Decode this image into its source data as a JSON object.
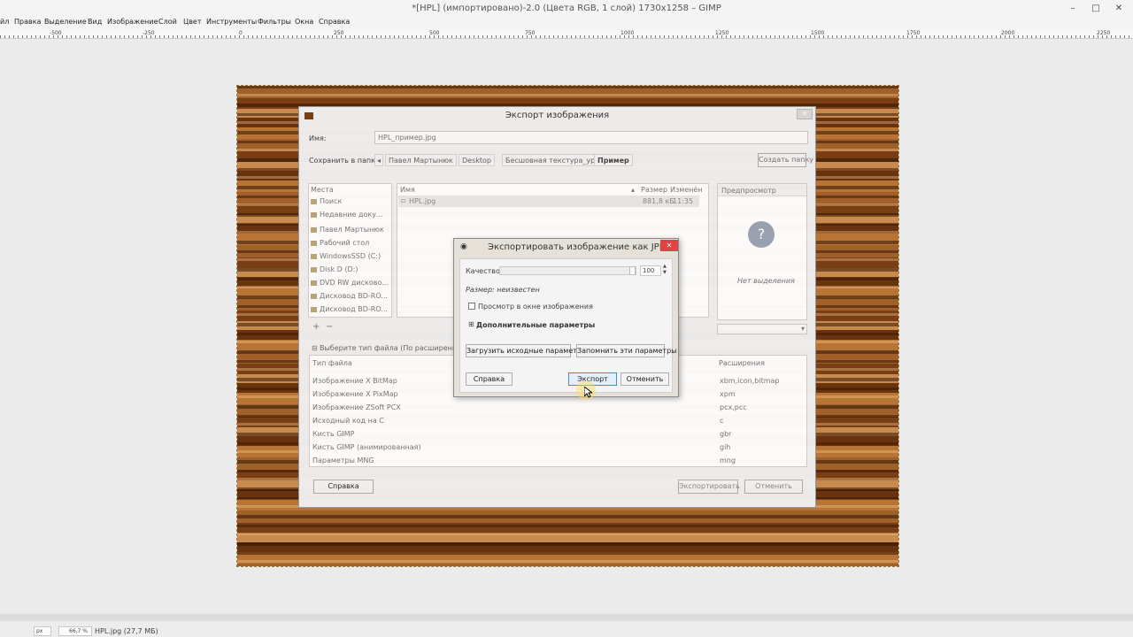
{
  "window": {
    "title": "*[HPL] (импортировано)-2.0 (Цвета RGB, 1 слой) 1730x1258 – GIMP",
    "controls": [
      "–",
      "□",
      "✕"
    ]
  },
  "menubar": {
    "items": [
      "йл",
      "Правка",
      "Выделение",
      "Вид",
      "Изображение",
      "Слой",
      "Цвет",
      "Инструменты",
      "Фильтры",
      "Окна",
      "Справка"
    ]
  },
  "ruler": {
    "labels": [
      "-500",
      "-250",
      "0",
      "250",
      "500",
      "750",
      "1000",
      "1250",
      "1500",
      "1750",
      "2000",
      "2250"
    ]
  },
  "export_dialog": {
    "title": "Экспорт изображения",
    "name_label": "Имя:",
    "name_value": "HPL_пример.jpg",
    "save_in_label": "Сохранить в папке",
    "breadcrumbs": [
      "Павел Мартынюк",
      "Desktop",
      "Бесшовная текстура_урок",
      "Пример"
    ],
    "create_folder": "Создать папку",
    "places_header": "Места",
    "places": [
      "Поиск",
      "Недавние доку...",
      "Павел Мартынюк",
      "Рабочий стол",
      "WindowsSSD (C:)",
      "Disk D (D:)",
      "DVD RW дисково...",
      "Дисковод BD-RO...",
      "Дисковод BD-RO..."
    ],
    "file_columns": [
      "Имя",
      "Размер",
      "Изменён"
    ],
    "files": [
      {
        "name": "HPL.jpg",
        "size": "881,8 кБ",
        "modified": "11:35"
      }
    ],
    "preview_header": "Предпросмотр",
    "preview_text": "Нет выделения",
    "filetype_toggle": "Выберите тип файла (По расширению)",
    "filetype_columns": [
      "Тип файла",
      "Расширения"
    ],
    "filetypes": [
      {
        "type": "Изображение X BitMap",
        "ext": "xbm,icon,bitmap"
      },
      {
        "type": "Изображение X PixMap",
        "ext": "xpm"
      },
      {
        "type": "Изображение ZSoft PCX",
        "ext": "pcx,pcc"
      },
      {
        "type": "Исходный код на C",
        "ext": "c"
      },
      {
        "type": "Кисть GIMP",
        "ext": "gbr"
      },
      {
        "type": "Кисть GIMP (анимированная)",
        "ext": "gih"
      },
      {
        "type": "Параметры MNG",
        "ext": "mng"
      }
    ],
    "help_button": "Справка",
    "export_button": "Экспортировать",
    "cancel_button": "Отменить"
  },
  "jpeg_dialog": {
    "title": "Экспортировать изображение как JPEG",
    "quality_label": "Качество:",
    "quality_value": "100",
    "quality_fraction": 1.0,
    "size_text": "Размер: неизвестен",
    "preview_checkbox": "Просмотр в окне изображения",
    "advanced_label": "Дополнительные параметры",
    "load_defaults": "Загрузить исходные параметры",
    "save_defaults": "Запомнить эти параметры",
    "help_button": "Справка",
    "export_button": "Экспорт",
    "cancel_button": "Отменить"
  },
  "statusbar": {
    "unit": "px",
    "zoom": "66,7 %",
    "file_info": "HPL.jpg (27,7 МБ)"
  },
  "colors": {
    "accent": "#3a8fd8",
    "wood_dark": "#6a3310",
    "wood_light": "#c98a4d",
    "close_red": "#e04343"
  }
}
